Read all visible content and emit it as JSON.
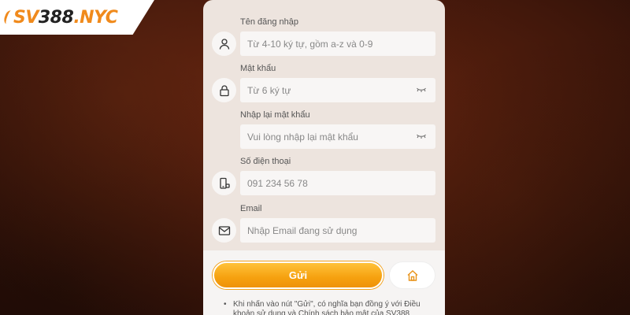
{
  "brand": {
    "logo_sv": "SV",
    "logo_num": "388",
    "logo_nyc": ".NYC"
  },
  "form": {
    "fields": [
      {
        "label": "Tên đăng nhập",
        "placeholder": "Từ 4-10 ký tự, gồm a-z và 0-9",
        "icon": "user-icon"
      },
      {
        "label": "Mật khẩu",
        "placeholder": "Từ 6 ký tự",
        "icon": "lock-icon"
      },
      {
        "label": "Nhập lại mật khẩu",
        "placeholder": "Vui lòng nhập lại mật khẩu"
      },
      {
        "label": "Số điện thoại",
        "placeholder": "091 234 56 78",
        "icon": "phone-icon"
      },
      {
        "label": "Email",
        "placeholder": "Nhập Email đang sử dụng",
        "icon": "mail-icon"
      }
    ],
    "submit_label": "Gửi",
    "home_icon": "home-icon",
    "note": "Khi nhấn vào nút \"Gửi\", có nghĩa bạn đồng ý với Điều khoản sử dụng và Chính sách bảo mật của SV388",
    "bullet": "•"
  },
  "colors": {
    "accent": "#f6a10f",
    "panel": "#ede4de",
    "background": "#4a1a0c"
  }
}
